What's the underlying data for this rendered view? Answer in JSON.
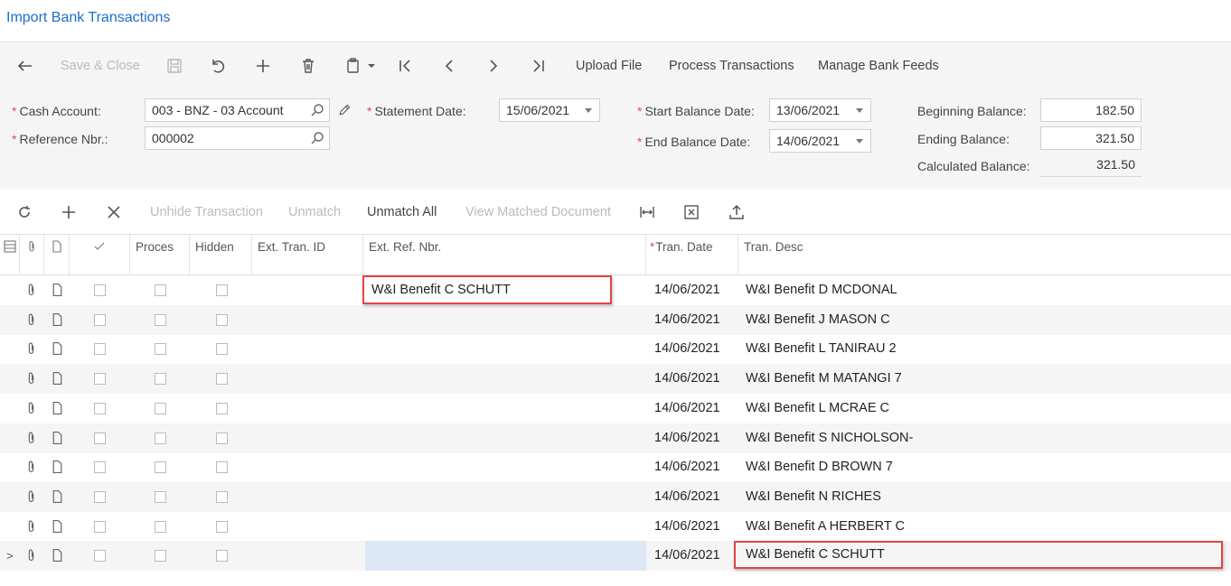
{
  "title": "Import Bank Transactions",
  "toolbar": {
    "save_close": "Save & Close",
    "upload_file": "Upload File",
    "process_transactions": "Process Transactions",
    "manage_bank_feeds": "Manage Bank Feeds"
  },
  "form": {
    "cash_account_label": "Cash Account:",
    "cash_account_value": "003 - BNZ - 03 Account",
    "reference_nbr_label": "Reference Nbr.:",
    "reference_nbr_value": "000002",
    "statement_date_label": "Statement Date:",
    "statement_date_value": "15/06/2021",
    "start_balance_date_label": "Start Balance Date:",
    "start_balance_date_value": "13/06/2021",
    "end_balance_date_label": "End Balance Date:",
    "end_balance_date_value": "14/06/2021",
    "beginning_balance_label": "Beginning Balance:",
    "beginning_balance_value": "182.50",
    "ending_balance_label": "Ending Balance:",
    "ending_balance_value": "321.50",
    "calculated_balance_label": "Calculated Balance:",
    "calculated_balance_value": "321.50",
    "required_mark": "*"
  },
  "grid_toolbar": {
    "unhide_transaction": "Unhide Transaction",
    "unmatch": "Unmatch",
    "unmatch_all": "Unmatch All",
    "view_matched_document": "View Matched Document"
  },
  "grid": {
    "columns": {
      "processed": "Proces",
      "hidden": "Hidden",
      "ext_tran_id": "Ext. Tran. ID",
      "ext_ref_nbr": "Ext. Ref. Nbr.",
      "tran_date": "Tran. Date",
      "tran_desc": "Tran. Desc"
    },
    "rows": [
      {
        "ext_ref_nbr": "W&I Benefit C SCHUTT",
        "tran_date": "14/06/2021",
        "tran_desc": "W&I Benefit D MCDONAL"
      },
      {
        "ext_ref_nbr": "",
        "tran_date": "14/06/2021",
        "tran_desc": "W&I Benefit J MASON C"
      },
      {
        "ext_ref_nbr": "",
        "tran_date": "14/06/2021",
        "tran_desc": "W&I Benefit L TANIRAU 2"
      },
      {
        "ext_ref_nbr": "",
        "tran_date": "14/06/2021",
        "tran_desc": "W&I Benefit M MATANGI 7"
      },
      {
        "ext_ref_nbr": "",
        "tran_date": "14/06/2021",
        "tran_desc": "W&I Benefit L MCRAE C"
      },
      {
        "ext_ref_nbr": "",
        "tran_date": "14/06/2021",
        "tran_desc": "W&I Benefit S NICHOLSON-"
      },
      {
        "ext_ref_nbr": "",
        "tran_date": "14/06/2021",
        "tran_desc": "W&I Benefit D BROWN 7"
      },
      {
        "ext_ref_nbr": "",
        "tran_date": "14/06/2021",
        "tran_desc": "W&I Benefit N RICHES"
      },
      {
        "ext_ref_nbr": "",
        "tran_date": "14/06/2021",
        "tran_desc": "W&I Benefit A HERBERT C"
      },
      {
        "ext_ref_nbr": "",
        "tran_date": "14/06/2021",
        "tran_desc": "W&I Benefit C SCHUTT"
      }
    ],
    "active_row_marker": ">"
  },
  "colors": {
    "title": "#1b6fc9",
    "required": "#d9534f",
    "highlight": "#e04545",
    "selected": "#dde8f6"
  }
}
